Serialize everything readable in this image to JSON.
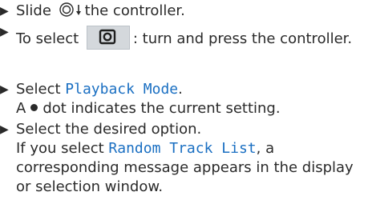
{
  "steps": [
    {
      "before": "Slide",
      "after": "the controller.",
      "icon": "controller-slide-down-icon"
    },
    {
      "before": "To select",
      "after": ": turn and press the controller.",
      "icon": "media-settings-icon"
    },
    {
      "before": "Select",
      "menu_item": "Playback Mode",
      "after": ".",
      "line2_before": "A",
      "line2_after": "dot indicates the current setting."
    },
    {
      "line1": "Select the desired option.",
      "line2_before": "If you select",
      "menu_item": "Random Track List",
      "line2_after": ", a corresponding message appears in the display or selection window."
    }
  ],
  "colors": {
    "text": "#2a2a2a",
    "menu_highlight": "#1a6fc2",
    "icon_box": "#d4d8dc"
  }
}
